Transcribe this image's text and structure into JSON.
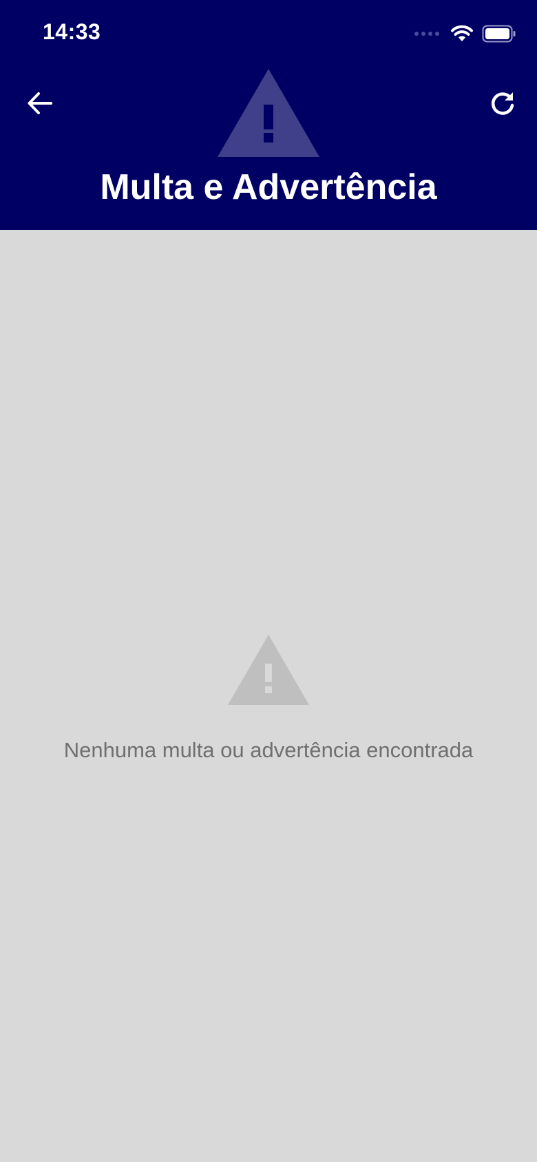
{
  "status_bar": {
    "time": "14:33",
    "icons": [
      "signal-dots-icon",
      "wifi-icon",
      "battery-icon"
    ]
  },
  "header": {
    "title": "Multa e Advertência",
    "icon": "warning-triangle-icon",
    "back_icon": "arrow-left-icon",
    "refresh_icon": "refresh-icon",
    "background_color": "#000064",
    "icon_color": "#3f3f8a"
  },
  "empty_state": {
    "icon": "warning-triangle-icon",
    "message": "Nenhuma multa ou advertência encontrada",
    "icon_color": "#bfbfbf",
    "text_color": "#707070"
  },
  "colors": {
    "background": "#d9d9d9"
  }
}
